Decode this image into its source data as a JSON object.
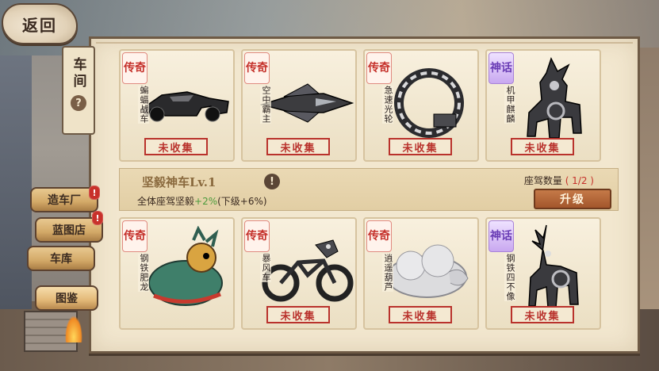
{
  "nav": {
    "back_label": "返回"
  },
  "side": {
    "title": "车间",
    "help_icon": "?"
  },
  "menu": [
    {
      "label": "造车厂",
      "badge": "!"
    },
    {
      "label": "蓝图店",
      "badge": "!"
    },
    {
      "label": "车库",
      "badge": ""
    },
    {
      "label": "图鉴",
      "badge": ""
    }
  ],
  "top_cards": [
    {
      "rarity": "传奇",
      "rarity_kind": "legend",
      "name": "蝙蝠战车",
      "status": "未收集",
      "icon": "bat-car-icon"
    },
    {
      "rarity": "传奇",
      "rarity_kind": "legend",
      "name": "空中霸主",
      "status": "未收集",
      "icon": "jet-icon"
    },
    {
      "rarity": "传奇",
      "rarity_kind": "legend",
      "name": "急速光轮",
      "status": "未收集",
      "icon": "wheel-icon"
    },
    {
      "rarity": "神话",
      "rarity_kind": "myth",
      "name": "机甲麒麟",
      "status": "未收集",
      "icon": "mecha-qilin-icon"
    }
  ],
  "info": {
    "title": "坚毅神车Lv.1",
    "warn_icon": "!",
    "desc_prefix": "全体座驾坚毅",
    "desc_buff": "+2%",
    "desc_next": "(下级+6%)",
    "count_label": "座驾数量",
    "count_value": "( 1/2 )",
    "upgrade_label": "升级"
  },
  "bottom_cards": [
    {
      "rarity": "传奇",
      "rarity_kind": "legend",
      "name": "钢铁肥龙",
      "status": "",
      "icon": "iron-dragon-icon"
    },
    {
      "rarity": "传奇",
      "rarity_kind": "legend",
      "name": "暴风车",
      "status": "未收集",
      "icon": "motorbike-icon"
    },
    {
      "rarity": "传奇",
      "rarity_kind": "legend",
      "name": "逍遥葫芦",
      "status": "未收集",
      "icon": "gourd-cloud-icon"
    },
    {
      "rarity": "神话",
      "rarity_kind": "myth",
      "name": "钢铁四不像",
      "status": "未收集",
      "icon": "iron-deer-icon"
    }
  ]
}
